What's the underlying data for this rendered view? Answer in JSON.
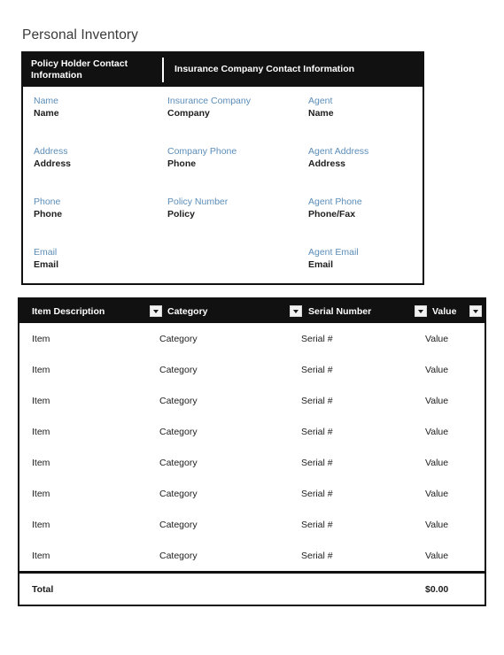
{
  "page": {
    "title": "Personal Inventory"
  },
  "contact": {
    "headers": {
      "left": "Policy Holder Contact Information",
      "right": "Insurance Company Contact Information"
    },
    "columns": [
      {
        "name": "policy-holder",
        "fields": [
          {
            "label": "Name",
            "value": "Name"
          },
          {
            "label": "Address",
            "value": "Address"
          },
          {
            "label": "Phone",
            "value": "Phone"
          },
          {
            "label": "Email",
            "value": "Email"
          }
        ]
      },
      {
        "name": "insurance-company",
        "fields": [
          {
            "label": "Insurance Company",
            "value": "Company"
          },
          {
            "label": "Company Phone",
            "value": "Phone"
          },
          {
            "label": "Policy Number",
            "value": "Policy"
          }
        ]
      },
      {
        "name": "agent",
        "fields": [
          {
            "label": "Agent",
            "value": "Name"
          },
          {
            "label": "Agent Address",
            "value": "Address"
          },
          {
            "label": "Agent Phone",
            "value": "Phone/Fax"
          },
          {
            "label": "Agent Email",
            "value": "Email"
          }
        ]
      }
    ]
  },
  "inventory": {
    "columns": [
      {
        "label": "Item Description",
        "filter": true
      },
      {
        "label": "Category",
        "filter": true
      },
      {
        "label": "Serial Number",
        "filter": true
      },
      {
        "label": "Value",
        "filter": true
      }
    ],
    "rows": [
      {
        "item": "Item",
        "category": "Category",
        "serial": "Serial #",
        "value": "Value"
      },
      {
        "item": "Item",
        "category": "Category",
        "serial": "Serial #",
        "value": "Value"
      },
      {
        "item": "Item",
        "category": "Category",
        "serial": "Serial #",
        "value": "Value"
      },
      {
        "item": "Item",
        "category": "Category",
        "serial": "Serial #",
        "value": "Value"
      },
      {
        "item": "Item",
        "category": "Category",
        "serial": "Serial #",
        "value": "Value"
      },
      {
        "item": "Item",
        "category": "Category",
        "serial": "Serial #",
        "value": "Value"
      },
      {
        "item": "Item",
        "category": "Category",
        "serial": "Serial #",
        "value": "Value"
      },
      {
        "item": "Item",
        "category": "Category",
        "serial": "Serial #",
        "value": "Value"
      }
    ],
    "total": {
      "label": "Total",
      "value": "$0.00"
    }
  },
  "colors": {
    "header_bg": "#111111",
    "label_blue": "#5b8db8",
    "text_dark": "#1d1d1d",
    "title_gray": "#3a3a3a"
  }
}
